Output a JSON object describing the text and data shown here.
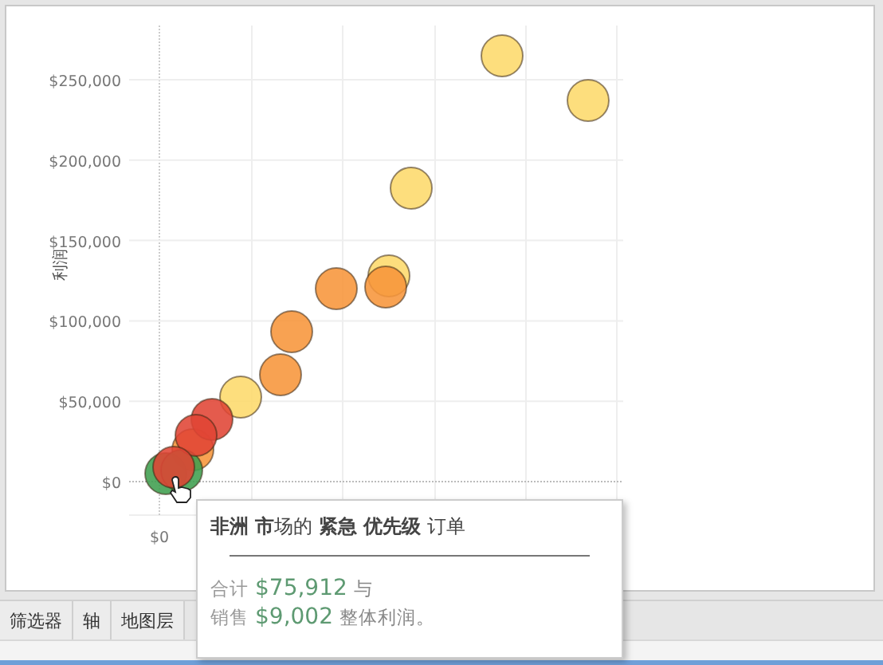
{
  "chart": {
    "y_axis_title": "利润",
    "x_tick_label": "$0",
    "y_tick_labels": [
      "$250,000",
      "$200,000",
      "$150,000",
      "$100,000",
      "$50,000",
      "$0"
    ]
  },
  "tooltip": {
    "title": "**非洲 市**场的 **紧急 优先级** 订单",
    "lines": [
      {
        "prefix": "合计",
        "value": "$75,912",
        "suffix": "与"
      },
      {
        "prefix": "销售",
        "value": "$9,002",
        "suffix": "整体利润。"
      }
    ]
  },
  "toolbar": {
    "tabs": [
      "筛选器",
      "轴",
      "地图层"
    ]
  }
}
